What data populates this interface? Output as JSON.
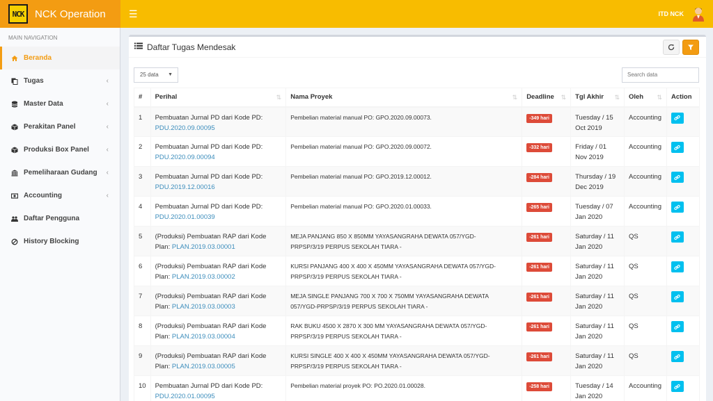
{
  "header": {
    "app_title": "NCK Operation",
    "logo_text": "NCK",
    "username": "ITD NCK"
  },
  "sidebar": {
    "heading": "MAIN NAVIGATION",
    "items": [
      {
        "label": "Beranda",
        "icon": "home-icon"
      },
      {
        "label": "Tugas",
        "icon": "copy-icon"
      },
      {
        "label": "Master Data",
        "icon": "database-icon"
      },
      {
        "label": "Perakitan Panel",
        "icon": "cube-icon"
      },
      {
        "label": "Produksi Box Panel",
        "icon": "cube-icon"
      },
      {
        "label": "Pemeliharaan Gudang",
        "icon": "bank-icon"
      },
      {
        "label": "Accounting",
        "icon": "money-icon"
      },
      {
        "label": "Daftar Pengguna",
        "icon": "users-icon"
      },
      {
        "label": "History Blocking",
        "icon": "ban-icon"
      }
    ]
  },
  "box": {
    "title": "Daftar Tugas Mendesak",
    "page_size": "25 data",
    "search_placeholder": "Search data"
  },
  "table": {
    "columns": [
      "#",
      "Perihal",
      "Nama Proyek",
      "Deadline",
      "Tgl Akhir",
      "Oleh",
      "Action"
    ],
    "rows": [
      {
        "no": "1",
        "perihal": "Pembuatan Jurnal PD dari Kode PD:",
        "kode": "PDU.2020.09.00095",
        "proyek": "Pembelian material manual PO: GPO.2020.09.00073.",
        "deadline": "-349 hari",
        "tgl1": "Tuesday / 15",
        "tgl2": "Oct 2019",
        "oleh": "Accounting"
      },
      {
        "no": "2",
        "perihal": "Pembuatan Jurnal PD dari Kode PD:",
        "kode": "PDU.2020.09.00094",
        "proyek": "Pembelian material manual PO: GPO.2020.09.00072.",
        "deadline": "-332 hari",
        "tgl1": "Friday / 01",
        "tgl2": "Nov 2019",
        "oleh": "Accounting"
      },
      {
        "no": "3",
        "perihal": "Pembuatan Jurnal PD dari Kode PD:",
        "kode": "PDU.2019.12.00016",
        "proyek": "Pembelian material manual PO: GPO.2019.12.00012.",
        "deadline": "-284 hari",
        "tgl1": "Thursday / 19",
        "tgl2": "Dec 2019",
        "oleh": "Accounting"
      },
      {
        "no": "4",
        "perihal": "Pembuatan Jurnal PD dari Kode PD:",
        "kode": "PDU.2020.01.00039",
        "proyek": "Pembelian material manual PO: GPO.2020.01.00033.",
        "deadline": "-265 hari",
        "tgl1": "Tuesday / 07",
        "tgl2": "Jan 2020",
        "oleh": "Accounting"
      },
      {
        "no": "5",
        "perihal": "(Produksi) Pembuatan RAP dari Kode",
        "perihal2": "Plan:",
        "kode": "PLAN.2019.03.00001",
        "proyek": "MEJA PANJANG 850 X 850MM YAYASANGRAHA DEWATA 057/YGD-",
        "proyek2": "PRPSP/3/19 PERPUS SEKOLAH TIARA -",
        "deadline": "-261 hari",
        "tgl1": "Saturday / 11",
        "tgl2": "Jan 2020",
        "oleh": "QS"
      },
      {
        "no": "6",
        "perihal": "(Produksi) Pembuatan RAP dari Kode",
        "perihal2": "Plan:",
        "kode": "PLAN.2019.03.00002",
        "proyek": "KURSI PANJANG 400 X 400 X 450MM YAYASANGRAHA DEWATA 057/YGD-",
        "proyek2": "PRPSP/3/19 PERPUS SEKOLAH TIARA -",
        "deadline": "-261 hari",
        "tgl1": "Saturday / 11",
        "tgl2": "Jan 2020",
        "oleh": "QS"
      },
      {
        "no": "7",
        "perihal": "(Produksi) Pembuatan RAP dari Kode",
        "perihal2": "Plan:",
        "kode": "PLAN.2019.03.00003",
        "proyek": "MEJA SINGLE PANJANG 700 X 700 X 750MM YAYASANGRAHA DEWATA",
        "proyek2": "057/YGD-PRPSP/3/19 PERPUS SEKOLAH TIARA -",
        "deadline": "-261 hari",
        "tgl1": "Saturday / 11",
        "tgl2": "Jan 2020",
        "oleh": "QS"
      },
      {
        "no": "8",
        "perihal": "(Produksi) Pembuatan RAP dari Kode",
        "perihal2": "Plan:",
        "kode": "PLAN.2019.03.00004",
        "proyek": "RAK BUKU 4500 X 2870 X 300 MM YAYASANGRAHA DEWATA 057/YGD-",
        "proyek2": "PRPSP/3/19 PERPUS SEKOLAH TIARA -",
        "deadline": "-261 hari",
        "tgl1": "Saturday / 11",
        "tgl2": "Jan 2020",
        "oleh": "QS"
      },
      {
        "no": "9",
        "perihal": "(Produksi) Pembuatan RAP dari Kode",
        "perihal2": "Plan:",
        "kode": "PLAN.2019.03.00005",
        "proyek": "KURSI SINGLE 400 X 400 X 450MM YAYASANGRAHA DEWATA 057/YGD-",
        "proyek2": "PRPSP/3/19 PERPUS SEKOLAH TIARA -",
        "deadline": "-261 hari",
        "tgl1": "Saturday / 11",
        "tgl2": "Jan 2020",
        "oleh": "QS"
      },
      {
        "no": "10",
        "perihal": "Pembuatan Jurnal PD dari Kode PD:",
        "kode": "PDU.2020.01.00095",
        "proyek": "Pembelian material proyek PO: PO.2020.01.00028.",
        "deadline": "-258 hari",
        "tgl1": "Tuesday / 14",
        "tgl2": "Jan 2020",
        "oleh": "Accounting"
      }
    ]
  },
  "colors": {
    "brand": "#f39c12",
    "topbar": "#f8bc00",
    "badge": "#dd4b39",
    "action": "#00c0ef",
    "link": "#3c8dbc"
  }
}
